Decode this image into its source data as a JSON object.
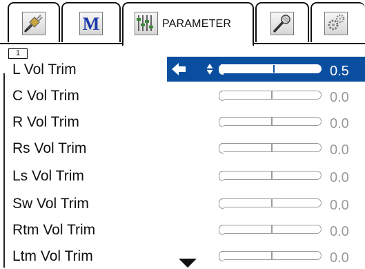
{
  "tabs": [
    {
      "id": "connect",
      "icon": "cable-plug-icon"
    },
    {
      "id": "mode",
      "icon": "m-logo-icon",
      "glyph": "M"
    },
    {
      "id": "parameter",
      "icon": "mixer-sliders-icon",
      "label": "PARAMETER",
      "active": true
    },
    {
      "id": "microphone",
      "icon": "microphone-icon"
    },
    {
      "id": "settings",
      "icon": "gears-icon"
    }
  ],
  "page_indicator": "1",
  "rows": [
    {
      "label": "L Vol Trim",
      "value": "0.5",
      "level": 0.52,
      "selected": true
    },
    {
      "label": "C Vol Trim",
      "value": "0.0",
      "level": 0.5
    },
    {
      "label": "R Vol Trim",
      "value": "0.0",
      "level": 0.5
    },
    {
      "label": "Rs Vol Trim",
      "value": "0.0",
      "level": 0.5
    },
    {
      "label": "Ls Vol Trim",
      "value": "0.0",
      "level": 0.5
    },
    {
      "label": "Sw Vol Trim",
      "value": "0.0",
      "level": 0.5
    },
    {
      "label": "Rtm Vol Trim",
      "value": "0.0",
      "level": 0.5
    },
    {
      "label": "Ltm Vol Trim",
      "value": "0.0",
      "level": 0.5
    }
  ],
  "colors": {
    "highlight": "#0a4ea0",
    "inactive_value": "#9a9a9a",
    "brand_m": "#1b3aa8"
  },
  "icons": {
    "back": "left-arrow-icon",
    "adjust": "up-down-arrows-icon",
    "more": "scroll-down-arrow-icon"
  }
}
